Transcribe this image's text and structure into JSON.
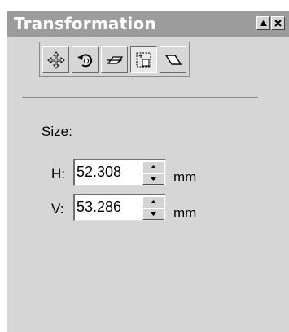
{
  "window": {
    "title": "Transformation",
    "minimize_icon": "triangle-up-icon",
    "close_icon": "close-icon"
  },
  "toolbar": {
    "tools": [
      {
        "name": "position",
        "icon": "move-arrows-icon"
      },
      {
        "name": "rotate",
        "icon": "rotate-icon"
      },
      {
        "name": "scale-mirror",
        "icon": "scale-mirror-icon"
      },
      {
        "name": "size",
        "icon": "size-icon",
        "active": true
      },
      {
        "name": "skew",
        "icon": "skew-icon"
      }
    ]
  },
  "size": {
    "label": "Size:",
    "h_label": "H:",
    "h_value": "52.308",
    "v_label": "V:",
    "v_value": "53.286",
    "unit": "mm"
  }
}
